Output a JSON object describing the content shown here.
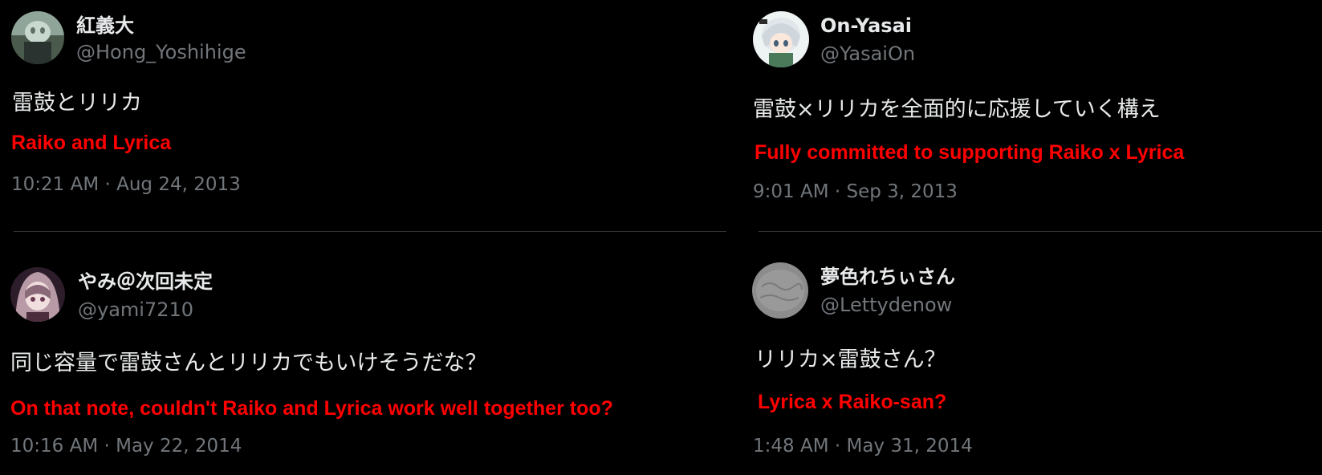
{
  "colors": {
    "background": "#000000",
    "primary_text": "#e7e9ea",
    "secondary_text": "#71767b",
    "translation": "#ff0000",
    "divider": "#2f3336"
  },
  "tweets": [
    {
      "display_name": "紅義大",
      "handle": "@Hong_Yoshihige",
      "text": "雷鼓とリリカ",
      "translation": "Raiko and Lyrica",
      "timestamp": "10:21 AM · Aug 24, 2013",
      "avatar_icon": "avatar-image"
    },
    {
      "display_name": "On-Yasai",
      "handle": "@YasaiOn",
      "text": "雷鼓×リリカを全面的に応援していく構え",
      "translation": "Fully committed to supporting Raiko x Lyrica",
      "timestamp": "9:01 AM · Sep 3, 2013",
      "avatar_icon": "avatar-image"
    },
    {
      "display_name": "やみ＠次回未定",
      "handle": "@yami7210",
      "text": "同じ容量で雷鼓さんとリリカでもいけそうだな？",
      "translation": "On that note, couldn't Raiko and Lyrica work well together too?",
      "timestamp": "10:16 AM · May 22, 2014",
      "avatar_icon": "avatar-image"
    },
    {
      "display_name": "夢色れちぃさん",
      "handle": "@Lettydenow",
      "text": "リリカ×雷鼓さん？",
      "translation": "Lyrica x Raiko-san?",
      "timestamp": "1:48 AM · May 31, 2014",
      "avatar_icon": "avatar-image"
    }
  ]
}
